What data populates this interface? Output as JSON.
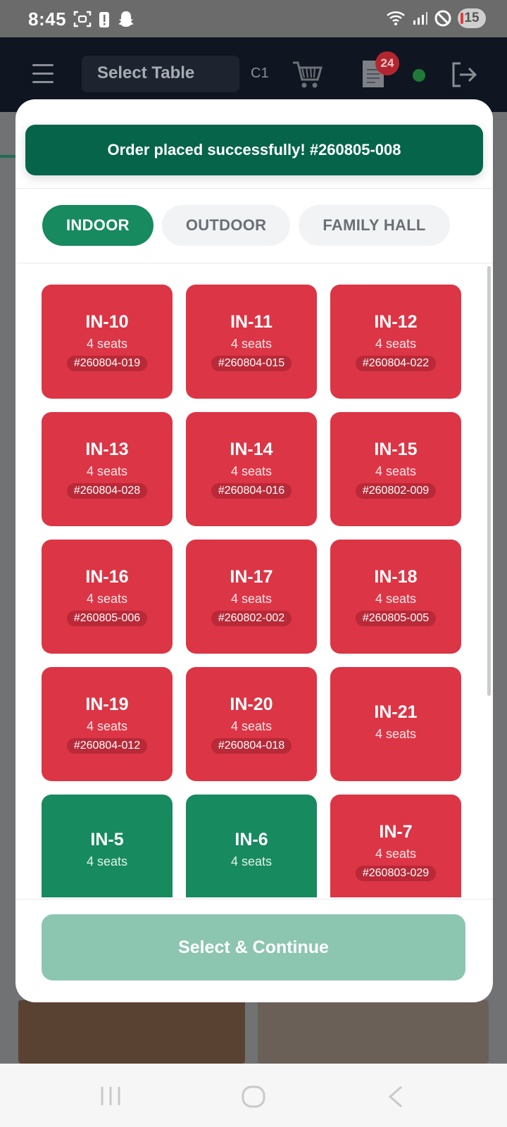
{
  "status_bar": {
    "time": "8:45",
    "battery": "15"
  },
  "header": {
    "select_table": "Select Table",
    "table_code": "C1",
    "notification_count": "24"
  },
  "toast": {
    "message": "Order placed successfully! #260805-008"
  },
  "tabs": [
    {
      "label": "INDOOR",
      "active": true
    },
    {
      "label": "OUTDOOR",
      "active": false
    },
    {
      "label": "FAMILY HALL",
      "active": false
    }
  ],
  "tables": [
    {
      "name": "IN-10",
      "seats": "4 seats",
      "order": "#260804-019",
      "status": "occupied"
    },
    {
      "name": "IN-11",
      "seats": "4 seats",
      "order": "#260804-015",
      "status": "occupied"
    },
    {
      "name": "IN-12",
      "seats": "4 seats",
      "order": "#260804-022",
      "status": "occupied"
    },
    {
      "name": "IN-13",
      "seats": "4 seats",
      "order": "#260804-028",
      "status": "occupied"
    },
    {
      "name": "IN-14",
      "seats": "4 seats",
      "order": "#260804-016",
      "status": "occupied"
    },
    {
      "name": "IN-15",
      "seats": "4 seats",
      "order": "#260802-009",
      "status": "occupied"
    },
    {
      "name": "IN-16",
      "seats": "4 seats",
      "order": "#260805-006",
      "status": "occupied"
    },
    {
      "name": "IN-17",
      "seats": "4 seats",
      "order": "#260802-002",
      "status": "occupied"
    },
    {
      "name": "IN-18",
      "seats": "4 seats",
      "order": "#260805-005",
      "status": "occupied"
    },
    {
      "name": "IN-19",
      "seats": "4 seats",
      "order": "#260804-012",
      "status": "occupied"
    },
    {
      "name": "IN-20",
      "seats": "4 seats",
      "order": "#260804-018",
      "status": "occupied"
    },
    {
      "name": "IN-21",
      "seats": "4 seats",
      "order": "",
      "status": "occupied"
    },
    {
      "name": "IN-5",
      "seats": "4 seats",
      "order": "",
      "status": "free"
    },
    {
      "name": "IN-6",
      "seats": "4 seats",
      "order": "",
      "status": "free"
    },
    {
      "name": "IN-7",
      "seats": "4 seats",
      "order": "#260803-029",
      "status": "occupied"
    }
  ],
  "footer": {
    "continue_label": "Select & Continue"
  },
  "colors": {
    "occupied": "#dc3545",
    "free": "#178a5f",
    "toast": "#05644a",
    "continue_disabled": "#8cc5b0"
  },
  "icons": [
    "hamburger-icon",
    "cart-icon",
    "document-icon",
    "logout-icon",
    "wifi-icon",
    "signal-icon",
    "dnd-icon"
  ]
}
